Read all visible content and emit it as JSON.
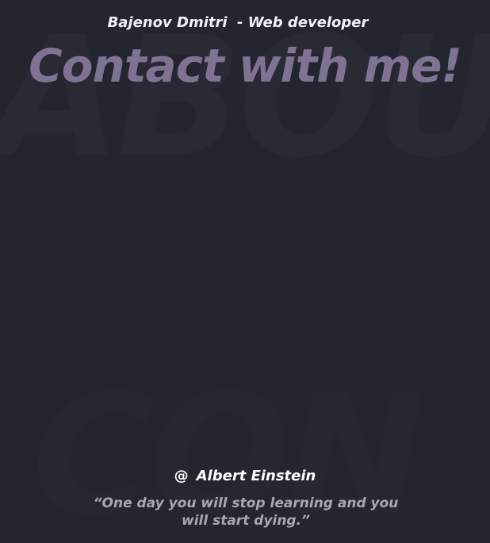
{
  "background": {
    "watermark_top": "ABOU",
    "watermark_bottom": "CON"
  },
  "header": {
    "subtitle": "Bajenov Dmitri  - Web developer"
  },
  "main": {
    "title": "Contact with me!"
  },
  "quote": {
    "author_icon": "@",
    "author": "Albert Einstein",
    "text": "“One day you will stop learning and you will start dying.”"
  },
  "colors": {
    "background": "#23252f",
    "title": "#7f7394",
    "subtitle": "#f1f1f6",
    "quote_text": "#a9a7b1",
    "watermark": "#2a2a35"
  }
}
